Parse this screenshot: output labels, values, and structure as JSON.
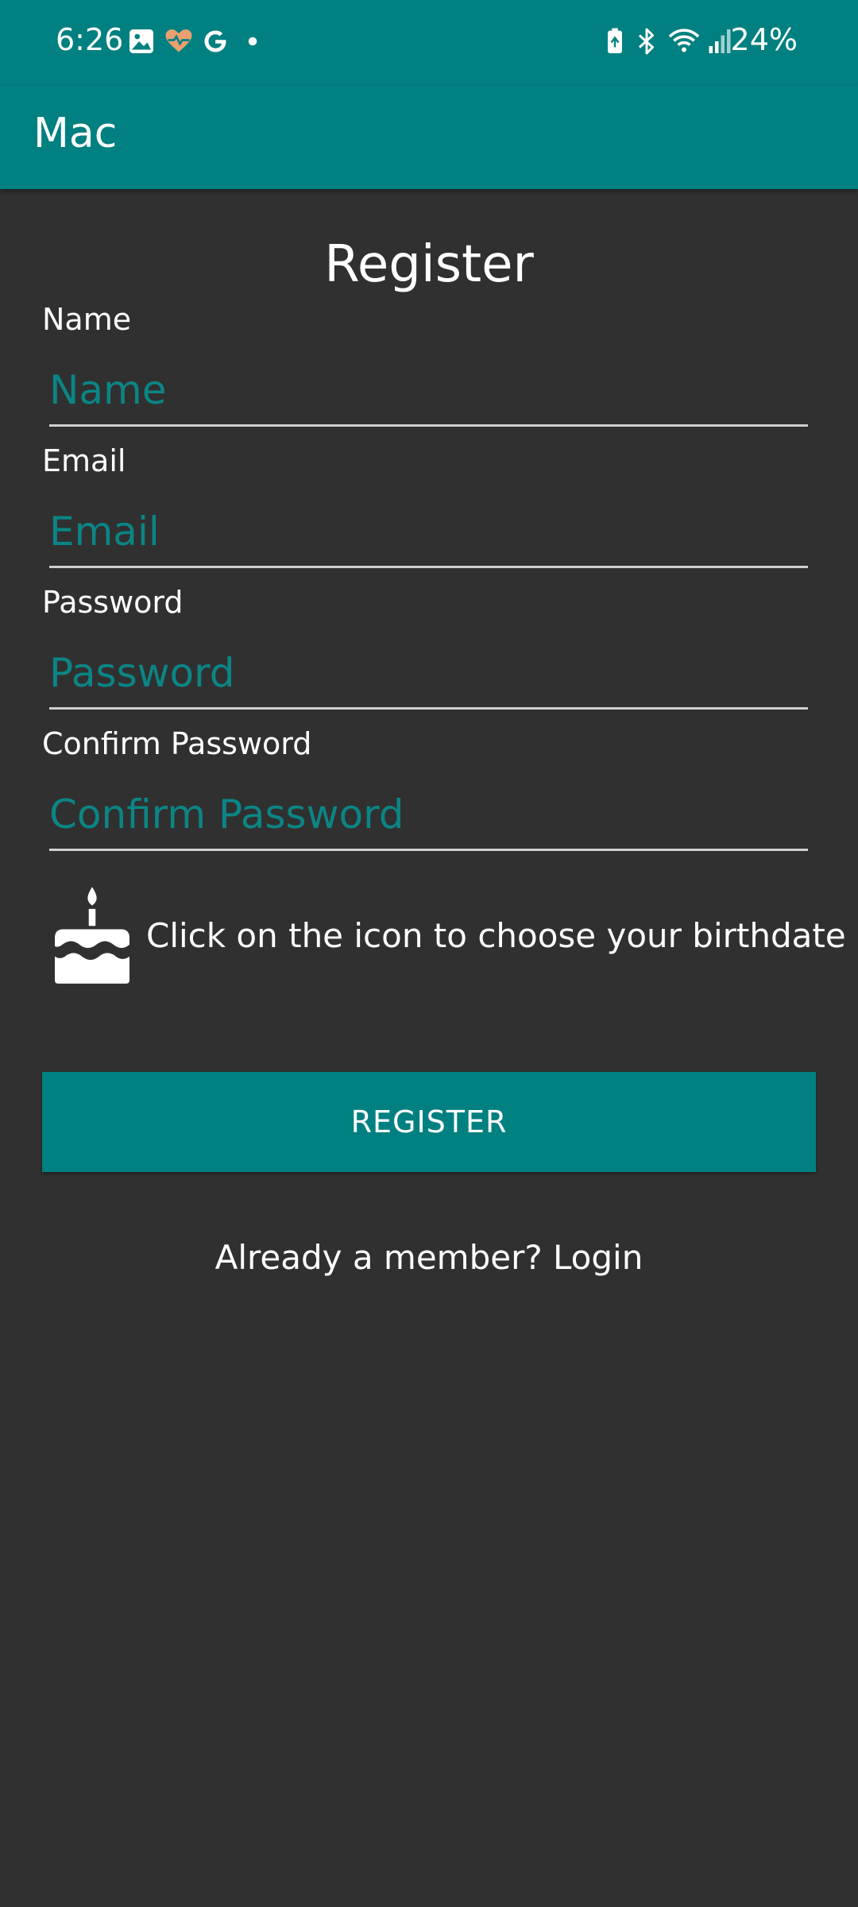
{
  "status_bar": {
    "time": "6:26",
    "battery": "24%",
    "icons": [
      "image-icon",
      "health-heart-icon",
      "google-icon",
      "dot-icon",
      "battery-saver-icon",
      "bluetooth-icon",
      "wifi-icon",
      "signal-icon"
    ]
  },
  "app_bar": {
    "title": "Mac"
  },
  "form": {
    "title": "Register",
    "fields": [
      {
        "label": "Name",
        "placeholder": "Name",
        "value": ""
      },
      {
        "label": "Email",
        "placeholder": "Email",
        "value": ""
      },
      {
        "label": "Password",
        "placeholder": "Password",
        "value": ""
      },
      {
        "label": "Confirm Password",
        "placeholder": "Confirm Password",
        "value": ""
      }
    ],
    "birthday_hint": "Click on the icon to choose your birthdate",
    "birthday_icon": "cake-icon",
    "register_label": "REGISTER",
    "login_link": "Already a member? Login"
  },
  "colors": {
    "primary": "#008080",
    "background": "#303030",
    "placeholder": "#0b8585",
    "text": "#ffffff",
    "heart_icon": "#e8a070"
  }
}
